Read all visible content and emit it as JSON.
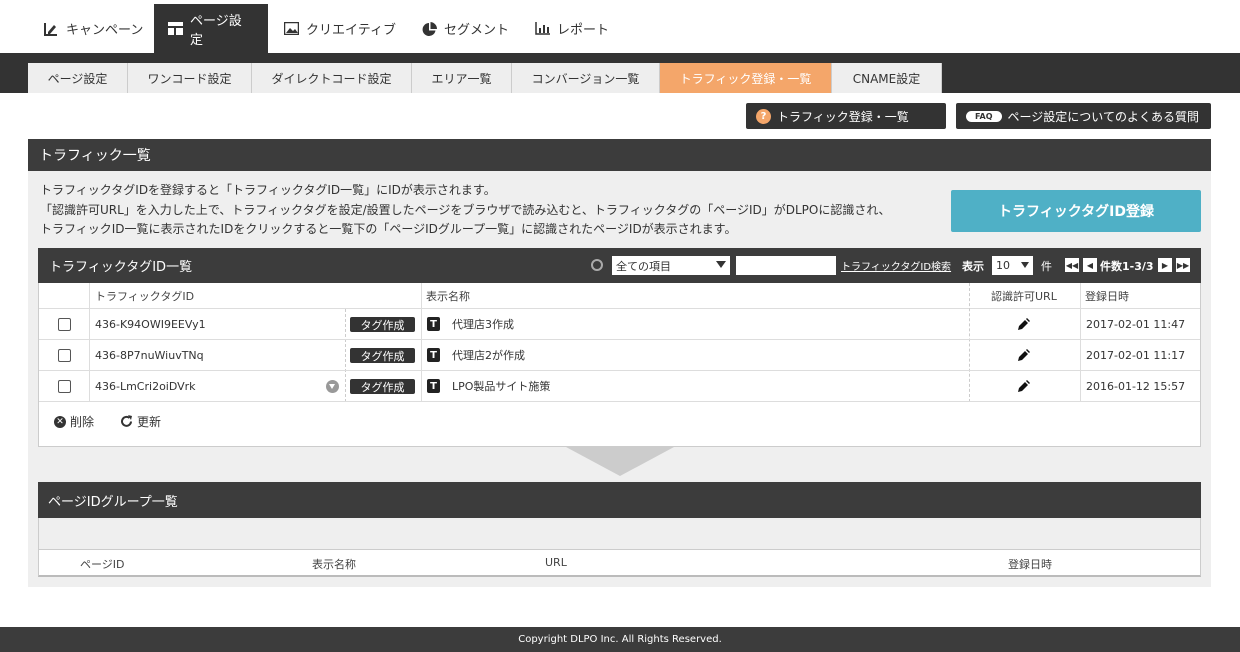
{
  "topnav": {
    "items": [
      {
        "label": "キャンペーン",
        "icon": "edit-chart-icon"
      },
      {
        "label": "ページ設定",
        "icon": "layout-icon",
        "active": true
      },
      {
        "label": "クリエイティブ",
        "icon": "image-icon"
      },
      {
        "label": "セグメント",
        "icon": "pie-chart-icon"
      },
      {
        "label": "レポート",
        "icon": "bar-chart-icon"
      }
    ]
  },
  "subnav": {
    "tabs": [
      {
        "label": "ページ設定"
      },
      {
        "label": "ワンコード設定"
      },
      {
        "label": "ダイレクトコード設定"
      },
      {
        "label": "エリア一覧"
      },
      {
        "label": "コンバージョン一覧"
      },
      {
        "label": "トラフィック登録・一覧",
        "active": true
      },
      {
        "label": "CNAME設定"
      }
    ]
  },
  "help": {
    "traffic_label": "トラフィック登録・一覧",
    "qmark": "?",
    "faq_badge": "FAQ",
    "faq_label": "ページ設定についてのよくある質問"
  },
  "panel": {
    "title": "トラフィック一覧",
    "desc1": "トラフィックタグIDを登録すると「トラフィックタグID一覧」にIDが表示されます。",
    "desc2": "「認識許可URL」を入力した上で、トラフィックタグを設定/設置したページをブラウザで読み込むと、トラフィックタグの「ページID」がDLPOに認識され、",
    "desc3": "トラフィックID一覧に表示されたIDをクリックすると一覧下の「ページIDグループ一覧」に認識されたページIDが表示されます。",
    "register_button": "トラフィックタグID登録"
  },
  "table": {
    "title": "トラフィックタグID一覧",
    "filter_selected": "全ての項目",
    "search_link": "トラフィックタグID検索",
    "display_label": "表示",
    "per_page": "10",
    "unit": "件",
    "page_info": "件数1-3/3",
    "headers": {
      "tag_id": "トラフィックタグID",
      "name": "表示名称",
      "url": "認識許可URL",
      "date": "登録日時"
    },
    "tag_button": "タグ作成",
    "type_icon": "T",
    "rows": [
      {
        "id": "436-K94OWI9EEVy1",
        "name": "代理店3作成",
        "date": "2017-02-01 11:47"
      },
      {
        "id": "436-8P7nuWiuvTNq",
        "name": "代理店2が作成",
        "date": "2017-02-01 11:17"
      },
      {
        "id": "436-LmCri2oiDVrk",
        "name": "LPO製品サイト施策",
        "date": "2016-01-12 15:57"
      }
    ],
    "delete_label": "削除",
    "refresh_label": "更新"
  },
  "group": {
    "title": "ページIDグループ一覧",
    "cols": {
      "page_id": "ページID",
      "name": "表示名称",
      "url": "URL",
      "date": "登録日時"
    }
  },
  "footer": {
    "copyright": "Copyright DLPO Inc. All Rights Reserved."
  }
}
